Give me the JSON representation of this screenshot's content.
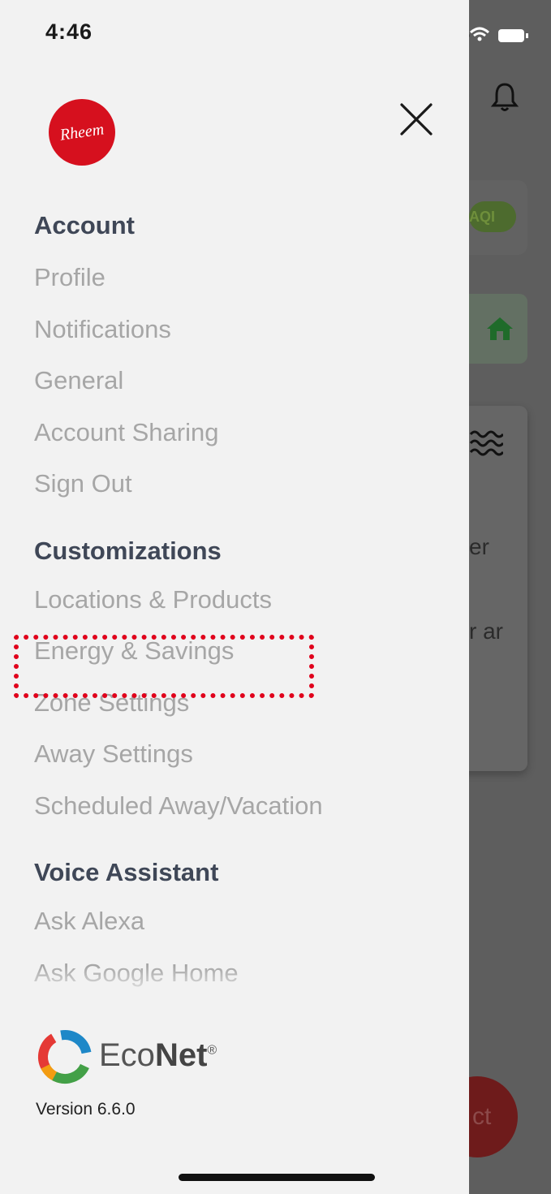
{
  "status_bar": {
    "time": "4:46"
  },
  "brand": {
    "logo_text": "Rheem"
  },
  "menu": {
    "sections": [
      {
        "title": "Account",
        "items": [
          "Profile",
          "Notifications",
          "General",
          "Account Sharing",
          "Sign Out"
        ]
      },
      {
        "title": "Customizations",
        "items": [
          "Locations & Products",
          "Energy & Savings",
          "Zone Settings",
          "Away Settings",
          "Scheduled Away/Vacation"
        ]
      },
      {
        "title": "Voice Assistant",
        "items": [
          "Ask Alexa",
          "Ask Google Home"
        ]
      }
    ]
  },
  "footer": {
    "product_eco": "Eco",
    "product_net": "Net",
    "product_mark": "®",
    "version": "Version 6.6.0"
  },
  "background_app": {
    "aqi_label": "AQI",
    "text_fragment_1": "er",
    "text_fragment_2": "r ar",
    "fab_label": "ct"
  },
  "colors": {
    "brand_red": "#d6101e",
    "highlight": "#e0001b",
    "drawer_bg": "#f2f2f2",
    "heading": "#3f4757",
    "item": "#a6a6a6"
  }
}
